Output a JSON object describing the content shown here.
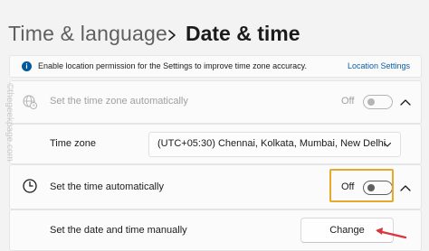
{
  "breadcrumb": {
    "parent": "Time & language",
    "separator_icon": "chevron-right-icon",
    "current": "Date & time"
  },
  "banner": {
    "icon": "info-icon",
    "text": "Enable location permission for the Settings to improve time zone accuracy.",
    "link": "Location Settings"
  },
  "set_time_zone_auto": {
    "icon": "globe-clock-icon",
    "label": "Set the time zone automatically",
    "toggle_text": "Off",
    "toggle_on": false,
    "disabled": true
  },
  "time_zone": {
    "label": "Time zone",
    "selected": "(UTC+05:30) Chennai, Kolkata, Mumbai, New Delhi"
  },
  "set_time_auto": {
    "icon": "clock-icon",
    "label": "Set the time automatically",
    "toggle_text": "Off",
    "toggle_on": false
  },
  "manual": {
    "label": "Set the date and time manually",
    "button": "Change"
  },
  "watermark": "©thegeekpage.com",
  "colors": {
    "accent": "#0b5ea8",
    "highlight": "#e8a92a",
    "arrow": "#d9363e",
    "background": "#f3f3f3"
  }
}
